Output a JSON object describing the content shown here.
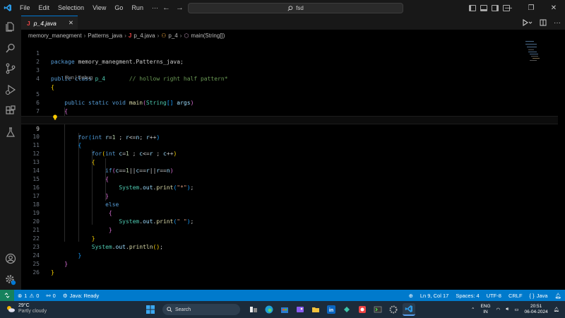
{
  "titlebar": {
    "menu": [
      "File",
      "Edit",
      "Selection",
      "View",
      "Go",
      "Run",
      "···"
    ],
    "nav_back": "←",
    "nav_forward": "→",
    "search_text": "fsd",
    "window_controls": [
      "—",
      "❐",
      "✕"
    ]
  },
  "activity_bar": {
    "icons": [
      "explorer-icon",
      "search-icon",
      "source-control-icon",
      "run-debug-icon",
      "extensions-icon",
      "testing-icon",
      "account-icon",
      "settings-icon"
    ]
  },
  "tab": {
    "label": "p_4.java",
    "lang_letter": "J",
    "close": "✕"
  },
  "breadcrumb": {
    "items": [
      "memory_manegment",
      "Patterns_java",
      "p_4.java",
      "p_4",
      "main(String[])"
    ],
    "j_letter": "J"
  },
  "editor": {
    "line_numbers": [
      "1",
      "2",
      "3",
      "4",
      "5",
      "6",
      "7",
      "8",
      "9",
      "10",
      "11",
      "12",
      "13",
      "14",
      "15",
      "16",
      "17",
      "18",
      "19",
      "20",
      "21",
      "22",
      "23",
      "24",
      "25",
      "26"
    ],
    "code_lens": "Run | Debug",
    "current_line": 9
  },
  "statusbar": {
    "errors": "1",
    "warnings": "0",
    "ports": "0",
    "java_status": "Java: Ready",
    "position": "Ln 9, Col 17",
    "spaces": "Spaces: 4",
    "encoding": "UTF-8",
    "eol": "CRLF",
    "language": "Java",
    "language_braces": "{ }"
  },
  "taskbar": {
    "temperature": "29°C",
    "weather": "Partly cloudy",
    "search_placeholder": "Search",
    "lang_top": "ENG",
    "lang_bottom": "IN",
    "time": "20:51",
    "date": "06-04-2024"
  },
  "colors": {
    "statusbar": "#007acc",
    "remote": "#16825d",
    "editor_bg": "#000000",
    "keyword": "#569cd6",
    "comment": "#6a9955",
    "string": "#ce9178"
  }
}
